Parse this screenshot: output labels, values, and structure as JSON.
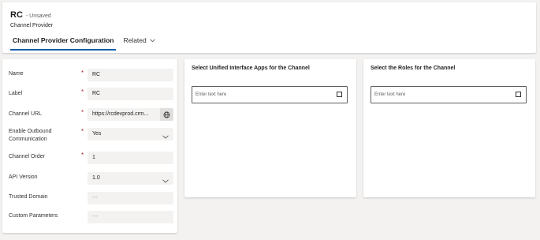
{
  "header": {
    "title": "RC",
    "status": "- Unsaved",
    "entity": "Channel Provider",
    "tabs": [
      {
        "label": "Channel Provider Configuration"
      },
      {
        "label": "Related"
      }
    ]
  },
  "form": {
    "fields": [
      {
        "label": "Name",
        "value": "RC"
      },
      {
        "label": "Label",
        "value": "RC"
      },
      {
        "label": "Channel URL",
        "value": "https://rcdevprod.crm..."
      },
      {
        "label": "Enable Outbound Communication",
        "value": "Yes"
      },
      {
        "label": "Channel Order",
        "value": "1"
      },
      {
        "label": "API Version",
        "value": "1.0"
      },
      {
        "label": "Trusted Domain",
        "value": "---"
      },
      {
        "label": "Custom Parameters",
        "value": "---"
      }
    ],
    "required_mark": "*"
  },
  "apps_panel": {
    "title": "Select Unified Interface Apps for the Channel",
    "placeholder": "Enter text here"
  },
  "roles_panel": {
    "title": "Select the Roles for the Channel",
    "placeholder": "Enter text here"
  },
  "colors": {
    "accent": "#115ea3",
    "required": "#a4262c",
    "background": "#f3f2f1"
  },
  "icons": [
    "chevron-down-icon",
    "globe-icon",
    "lookup-square-icon"
  ]
}
